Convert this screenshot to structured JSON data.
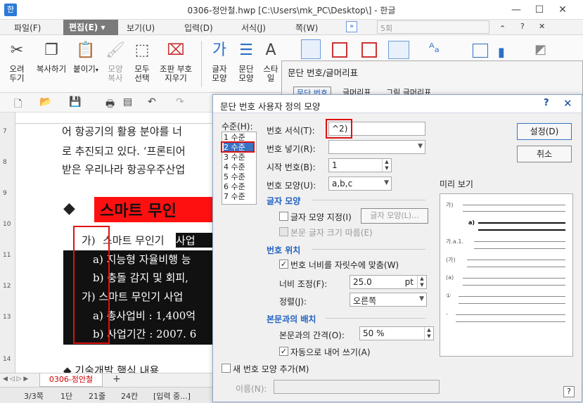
{
  "window": {
    "title": "0306-정안철.hwp [C:\\Users\\mk_PC\\Desktop\\] - 한글",
    "app_icon": "한",
    "minimize": "—",
    "restore": "☐",
    "close": "✕"
  },
  "menu": {
    "file": "파일(F)",
    "edit": "편집(E)",
    "view": "보기(U)",
    "input": "입력(D)",
    "format": "서식(J)",
    "page": "쪽(W)",
    "style_box": "5회",
    "caret": "⌃",
    "help": "?",
    "close": "✕"
  },
  "ribbon": {
    "cut": "오려\n두기",
    "copy": "복사하기",
    "paste": "붙이기",
    "format_copy": "모양\n복사",
    "select_all": "모두\n선택",
    "strip_code": "조판 부호\n지우기",
    "char_shape": "글자\n모양",
    "para_shape": "문단\n모양",
    "style": "스타일"
  },
  "doc_tab": "0306-정안철",
  "add_tab": "+",
  "status": {
    "page": "3/3쪽",
    "section": "1단",
    "line": "21줄",
    "col": "24칸",
    "mode": "[입력 중...]"
  },
  "bg_dialog": {
    "title": "문단 번호/글머리표",
    "tab1": "문단 번호",
    "tab2": "글머리표",
    "tab3": "그림 글머리표"
  },
  "document": {
    "line1": "어 항공기의 활용 분야를 너",
    "line2": "로 추진되고 있다. ‘프론티어",
    "line3": "받은 우리나라 항공우주산업",
    "heading_bullet": "◆",
    "heading": "스마트 무인",
    "item1_num": "가)",
    "item1_text": "스마트 무인기 ",
    "item1_tail": "사업",
    "item2": "a) 지능형 자율비행 능",
    "item3": "b) 충돌 감지 및 회피,",
    "item4": "가) 스마트 무인기 사업",
    "item5": "a) 총사업비 : 1,400억",
    "item6": "b) 사업기간 : 2007. 6",
    "next": "◆ 기술개발 핵심 내용"
  },
  "dialog": {
    "title": "문단 번호 사용자 정의 모양",
    "help": "?",
    "close": "✕",
    "level_label": "수준(H):",
    "levels": [
      "1 수준",
      "2 수준",
      "3 수준",
      "4 수준",
      "5 수준",
      "6 수준",
      "7 수준"
    ],
    "number_format_label": "번호 서식(T):",
    "number_format_value": "^2)",
    "number_insert_label": "번호 넣기(R):",
    "start_number_label": "시작 번호(B):",
    "start_number_value": "1",
    "number_shape_label": "번호 모양(U):",
    "number_shape_value": "a,b,c",
    "ok": "설정(D)",
    "cancel": "취소",
    "char_section": "글자 모양",
    "char_shape_check": "글자 모양 지정(I)",
    "char_shape_btn": "글자 모양(L)...",
    "follow_size": "본문 글자 크기 따름(E)",
    "pos_section": "번호 위치",
    "fit_width": "번호 너비를 자릿수에 맞춤(W)",
    "width_label": "너비 조정(F):",
    "width_value": "25.0",
    "width_unit": "pt",
    "align_label": "정렬(J):",
    "align_value": "오른쪽",
    "body_section": "본문과의 배치",
    "gap_label": "본문과의 간격(O):",
    "gap_value": "50 %",
    "auto_indent": "자동으로 내어 쓰기(A)",
    "add_new": "새 번호 모양 추가(M)",
    "name_label": "이름(N):",
    "preview_label": "미리 보기",
    "preview_marks": [
      "가)",
      "a)",
      "가.a.1.",
      "(가)",
      "(a)",
      "①",
      "-"
    ],
    "help_corner": "?"
  }
}
